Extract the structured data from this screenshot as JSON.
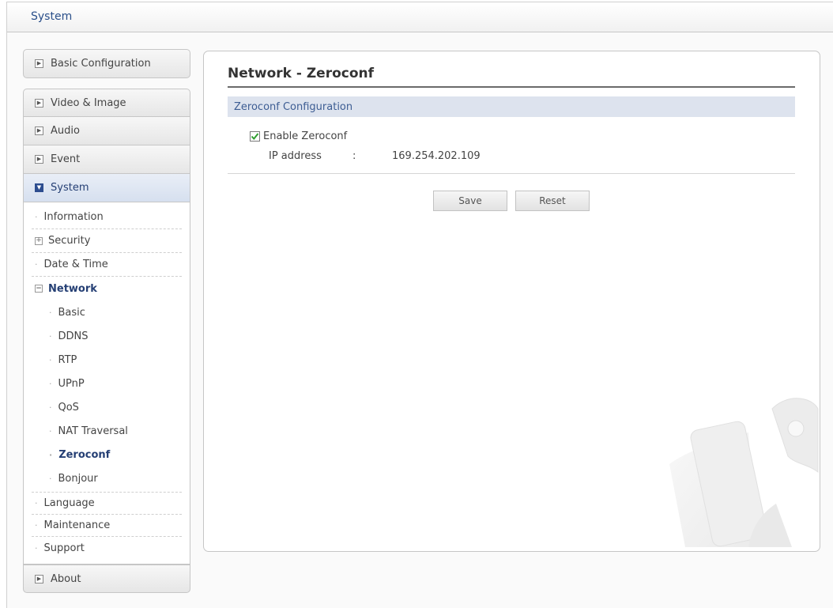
{
  "header": {
    "title": "System"
  },
  "sidebar": {
    "basic_configuration": "Basic Configuration",
    "video_image": "Video & Image",
    "audio": "Audio",
    "event": "Event",
    "system": "System",
    "system_items": {
      "information": "Information",
      "security": "Security",
      "date_time": "Date & Time",
      "network": "Network",
      "network_items": [
        "Basic",
        "DDNS",
        "RTP",
        "UPnP",
        "QoS",
        "NAT Traversal",
        "Zeroconf",
        "Bonjour"
      ],
      "language": "Language",
      "maintenance": "Maintenance",
      "support": "Support"
    },
    "about": "About"
  },
  "main": {
    "title": "Network - Zeroconf",
    "section_title": "Zeroconf Configuration",
    "enable_label": "Enable Zeroconf",
    "enable_checked": true,
    "ip_label": "IP address",
    "ip_colon": ":",
    "ip_value": "169.254.202.109",
    "save_label": "Save",
    "reset_label": "Reset"
  },
  "colors": {
    "accent": "#253f74",
    "section_bg": "#dde3ee",
    "checkbox_check": "#2f9e2f"
  }
}
